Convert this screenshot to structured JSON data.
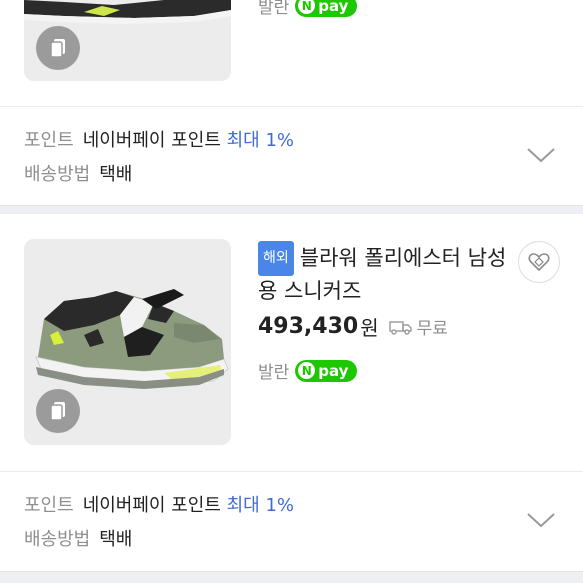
{
  "products": [
    {
      "seller": "발란",
      "npay_label": "pay",
      "npay_mark": "N",
      "point_label": "포인트",
      "point_value": "네이버페이 포인트",
      "point_highlight": "최대 1%",
      "delivery_label": "배송방법",
      "delivery_value": "택배"
    },
    {
      "tag": "해외",
      "title": "블라워 폴리에스터 남성용 스니커즈",
      "price": "493,430",
      "price_unit": "원",
      "shipping": "무료",
      "seller": "발란",
      "npay_label": "pay",
      "npay_mark": "N",
      "point_label": "포인트",
      "point_value": "네이버페이 포인트",
      "point_highlight": "최대 1%",
      "delivery_label": "배송방법",
      "delivery_value": "택배"
    }
  ],
  "colors": {
    "npay": "#1ec800",
    "tag": "#4a86e8",
    "highlight": "#3e6bd6"
  }
}
